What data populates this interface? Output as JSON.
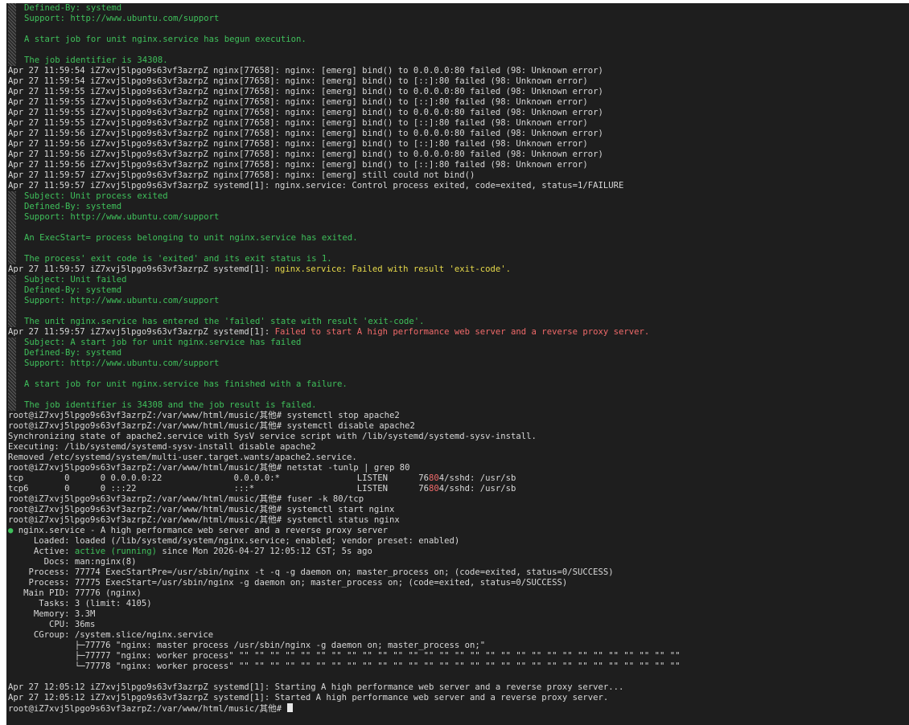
{
  "colors": {
    "background": "#1e1e1e",
    "text": "#d8d8d8",
    "journal": "#3fc05b",
    "warning": "#e6d94a",
    "error": "#f06a6a",
    "active": "#3fc05b"
  },
  "lines": [
    {
      "type": "journal",
      "text": "Defined-By: systemd"
    },
    {
      "type": "journal",
      "text": "Support: http://www.ubuntu.com/support"
    },
    {
      "type": "journal",
      "text": ""
    },
    {
      "type": "journal",
      "text": "A start job for unit nginx.service has begun execution."
    },
    {
      "type": "journal",
      "text": ""
    },
    {
      "type": "journal",
      "text": "The job identifier is 34308."
    },
    {
      "type": "text",
      "segments": [
        {
          "text": "Apr 27 11:59:54 iZ7xvj5lpgo9s63vf3azrpZ nginx[77658]: nginx: [emerg] bind() to 0.0.0.0:80 failed (98: Unknown error)",
          "color": "plain"
        }
      ]
    },
    {
      "type": "text",
      "segments": [
        {
          "text": "Apr 27 11:59:54 iZ7xvj5lpgo9s63vf3azrpZ nginx[77658]: nginx: [emerg] bind() to [::]:80 failed (98: Unknown error)",
          "color": "plain"
        }
      ]
    },
    {
      "type": "text",
      "segments": [
        {
          "text": "Apr 27 11:59:55 iZ7xvj5lpgo9s63vf3azrpZ nginx[77658]: nginx: [emerg] bind() to 0.0.0.0:80 failed (98: Unknown error)",
          "color": "plain"
        }
      ]
    },
    {
      "type": "text",
      "segments": [
        {
          "text": "Apr 27 11:59:55 iZ7xvj5lpgo9s63vf3azrpZ nginx[77658]: nginx: [emerg] bind() to [::]:80 failed (98: Unknown error)",
          "color": "plain"
        }
      ]
    },
    {
      "type": "text",
      "segments": [
        {
          "text": "Apr 27 11:59:55 iZ7xvj5lpgo9s63vf3azrpZ nginx[77658]: nginx: [emerg] bind() to 0.0.0.0:80 failed (98: Unknown error)",
          "color": "plain"
        }
      ]
    },
    {
      "type": "text",
      "segments": [
        {
          "text": "Apr 27 11:59:55 iZ7xvj5lpgo9s63vf3azrpZ nginx[77658]: nginx: [emerg] bind() to [::]:80 failed (98: Unknown error)",
          "color": "plain"
        }
      ]
    },
    {
      "type": "text",
      "segments": [
        {
          "text": "Apr 27 11:59:56 iZ7xvj5lpgo9s63vf3azrpZ nginx[77658]: nginx: [emerg] bind() to 0.0.0.0:80 failed (98: Unknown error)",
          "color": "plain"
        }
      ]
    },
    {
      "type": "text",
      "segments": [
        {
          "text": "Apr 27 11:59:56 iZ7xvj5lpgo9s63vf3azrpZ nginx[77658]: nginx: [emerg] bind() to [::]:80 failed (98: Unknown error)",
          "color": "plain"
        }
      ]
    },
    {
      "type": "text",
      "segments": [
        {
          "text": "Apr 27 11:59:56 iZ7xvj5lpgo9s63vf3azrpZ nginx[77658]: nginx: [emerg] bind() to 0.0.0.0:80 failed (98: Unknown error)",
          "color": "plain"
        }
      ]
    },
    {
      "type": "text",
      "segments": [
        {
          "text": "Apr 27 11:59:56 iZ7xvj5lpgo9s63vf3azrpZ nginx[77658]: nginx: [emerg] bind() to [::]:80 failed (98: Unknown error)",
          "color": "plain"
        }
      ]
    },
    {
      "type": "text",
      "segments": [
        {
          "text": "Apr 27 11:59:57 iZ7xvj5lpgo9s63vf3azrpZ nginx[77658]: nginx: [emerg] still could not bind()",
          "color": "plain"
        }
      ]
    },
    {
      "type": "text",
      "segments": [
        {
          "text": "Apr 27 11:59:57 iZ7xvj5lpgo9s63vf3azrpZ systemd[1]: nginx.service: Control process exited, code=exited, status=1/FAILURE",
          "color": "plain"
        }
      ]
    },
    {
      "type": "journal",
      "text": "Subject: Unit process exited"
    },
    {
      "type": "journal",
      "text": "Defined-By: systemd"
    },
    {
      "type": "journal",
      "text": "Support: http://www.ubuntu.com/support"
    },
    {
      "type": "journal",
      "text": ""
    },
    {
      "type": "journal",
      "text": "An ExecStart= process belonging to unit nginx.service has exited."
    },
    {
      "type": "journal",
      "text": ""
    },
    {
      "type": "journal",
      "text": "The process' exit code is 'exited' and its exit status is 1."
    },
    {
      "type": "text",
      "segments": [
        {
          "text": "Apr 27 11:59:57 iZ7xvj5lpgo9s63vf3azrpZ systemd[1]: ",
          "color": "plain"
        },
        {
          "text": "nginx.service: Failed with result 'exit-code'.",
          "color": "yellow"
        }
      ]
    },
    {
      "type": "journal",
      "text": "Subject: Unit failed"
    },
    {
      "type": "journal",
      "text": "Defined-By: systemd"
    },
    {
      "type": "journal",
      "text": "Support: http://www.ubuntu.com/support"
    },
    {
      "type": "journal",
      "text": ""
    },
    {
      "type": "journal",
      "text": "The unit nginx.service has entered the 'failed' state with result 'exit-code'."
    },
    {
      "type": "text",
      "segments": [
        {
          "text": "Apr 27 11:59:57 iZ7xvj5lpgo9s63vf3azrpZ systemd[1]: ",
          "color": "plain"
        },
        {
          "text": "Failed to start A high performance web server and a reverse proxy server.",
          "color": "red"
        }
      ]
    },
    {
      "type": "journal",
      "text": "Subject: A start job for unit nginx.service has failed"
    },
    {
      "type": "journal",
      "text": "Defined-By: systemd"
    },
    {
      "type": "journal",
      "text": "Support: http://www.ubuntu.com/support"
    },
    {
      "type": "journal",
      "text": ""
    },
    {
      "type": "journal",
      "text": "A start job for unit nginx.service has finished with a failure."
    },
    {
      "type": "journal",
      "text": ""
    },
    {
      "type": "journal",
      "text": "The job identifier is 34308 and the job result is failed."
    },
    {
      "type": "text",
      "segments": [
        {
          "text": "root@iZ7xvj5lpgo9s63vf3azrpZ:/var/www/html/music/其他# systemctl stop apache2",
          "color": "plain"
        }
      ]
    },
    {
      "type": "text",
      "segments": [
        {
          "text": "root@iZ7xvj5lpgo9s63vf3azrpZ:/var/www/html/music/其他# systemctl disable apache2",
          "color": "plain"
        }
      ]
    },
    {
      "type": "text",
      "segments": [
        {
          "text": "Synchronizing state of apache2.service with SysV service script with /lib/systemd/systemd-sysv-install.",
          "color": "plain"
        }
      ]
    },
    {
      "type": "text",
      "segments": [
        {
          "text": "Executing: /lib/systemd/systemd-sysv-install disable apache2",
          "color": "plain"
        }
      ]
    },
    {
      "type": "text",
      "segments": [
        {
          "text": "Removed /etc/systemd/system/multi-user.target.wants/apache2.service.",
          "color": "plain"
        }
      ]
    },
    {
      "type": "text",
      "segments": [
        {
          "text": "root@iZ7xvj5lpgo9s63vf3azrpZ:/var/www/html/music/其他# netstat -tunlp | grep 80",
          "color": "plain"
        }
      ]
    },
    {
      "type": "text",
      "segments": [
        {
          "text": "tcp        0      0 0.0.0.0:22              0.0.0.0:*               LISTEN      76",
          "color": "plain"
        },
        {
          "text": "80",
          "color": "red"
        },
        {
          "text": "4/sshd: /usr/sb",
          "color": "plain"
        }
      ]
    },
    {
      "type": "text",
      "segments": [
        {
          "text": "tcp6       0      0 :::22                   :::*                    LISTEN      76",
          "color": "plain"
        },
        {
          "text": "80",
          "color": "red"
        },
        {
          "text": "4/sshd: /usr/sb",
          "color": "plain"
        }
      ]
    },
    {
      "type": "text",
      "segments": [
        {
          "text": "root@iZ7xvj5lpgo9s63vf3azrpZ:/var/www/html/music/其他# fuser -k 80/tcp",
          "color": "plain"
        }
      ]
    },
    {
      "type": "text",
      "segments": [
        {
          "text": "root@iZ7xvj5lpgo9s63vf3azrpZ:/var/www/html/music/其他# systemctl start nginx",
          "color": "plain"
        }
      ]
    },
    {
      "type": "text",
      "segments": [
        {
          "text": "root@iZ7xvj5lpgo9s63vf3azrpZ:/var/www/html/music/其他# systemctl status nginx",
          "color": "plain"
        }
      ]
    },
    {
      "type": "text",
      "segments": [
        {
          "text": "● ",
          "color": "green"
        },
        {
          "text": "nginx.service - A high performance web server and a reverse proxy server",
          "color": "plain"
        }
      ]
    },
    {
      "type": "text",
      "segments": [
        {
          "text": "     Loaded: loaded (/lib/systemd/system/nginx.service; enabled; vendor preset: enabled)",
          "color": "plain"
        }
      ]
    },
    {
      "type": "text",
      "segments": [
        {
          "text": "     Active: ",
          "color": "plain"
        },
        {
          "text": "active (running)",
          "color": "green"
        },
        {
          "text": " since Mon 2026-04-27 12:05:12 CST; 5s ago",
          "color": "plain"
        }
      ]
    },
    {
      "type": "text",
      "segments": [
        {
          "text": "       Docs: man:nginx(8)",
          "color": "plain"
        }
      ]
    },
    {
      "type": "text",
      "segments": [
        {
          "text": "    Process: 77774 ExecStartPre=/usr/sbin/nginx -t -q -g daemon on; master_process on; (code=exited, status=0/SUCCESS)",
          "color": "plain"
        }
      ]
    },
    {
      "type": "text",
      "segments": [
        {
          "text": "    Process: 77775 ExecStart=/usr/sbin/nginx -g daemon on; master_process on; (code=exited, status=0/SUCCESS)",
          "color": "plain"
        }
      ]
    },
    {
      "type": "text",
      "segments": [
        {
          "text": "   Main PID: 77776 (nginx)",
          "color": "plain"
        }
      ]
    },
    {
      "type": "text",
      "segments": [
        {
          "text": "      Tasks: 3 (limit: 4105)",
          "color": "plain"
        }
      ]
    },
    {
      "type": "text",
      "segments": [
        {
          "text": "     Memory: 3.3M",
          "color": "plain"
        }
      ]
    },
    {
      "type": "text",
      "segments": [
        {
          "text": "        CPU: 36ms",
          "color": "plain"
        }
      ]
    },
    {
      "type": "text",
      "segments": [
        {
          "text": "     CGroup: /system.slice/nginx.service",
          "color": "plain"
        }
      ]
    },
    {
      "type": "text",
      "segments": [
        {
          "text": "             ├─77776 \"nginx: master process /usr/sbin/nginx -g daemon on; master_process on;\"",
          "color": "plain"
        }
      ]
    },
    {
      "type": "text",
      "segments": [
        {
          "text": "             ├─77777 \"nginx: worker process\" \"\" \"\" \"\" \"\" \"\" \"\" \"\" \"\" \"\" \"\" \"\" \"\" \"\" \"\" \"\" \"\" \"\" \"\" \"\" \"\" \"\" \"\" \"\" \"\" \"\" \"\" \"\" \"\" \"\"",
          "color": "plain"
        }
      ]
    },
    {
      "type": "text",
      "segments": [
        {
          "text": "             └─77778 \"nginx: worker process\" \"\" \"\" \"\" \"\" \"\" \"\" \"\" \"\" \"\" \"\" \"\" \"\" \"\" \"\" \"\" \"\" \"\" \"\" \"\" \"\" \"\" \"\" \"\" \"\" \"\" \"\" \"\" \"\" \"\"",
          "color": "plain"
        }
      ]
    },
    {
      "type": "text",
      "segments": [
        {
          "text": "",
          "color": "plain"
        }
      ]
    },
    {
      "type": "text",
      "segments": [
        {
          "text": "Apr 27 12:05:12 iZ7xvj5lpgo9s63vf3azrpZ systemd[1]: Starting A high performance web server and a reverse proxy server...",
          "color": "plain"
        }
      ]
    },
    {
      "type": "text",
      "segments": [
        {
          "text": "Apr 27 12:05:12 iZ7xvj5lpgo9s63vf3azrpZ systemd[1]: Started A high performance web server and a reverse proxy server.",
          "color": "plain"
        }
      ]
    },
    {
      "type": "prompt",
      "segments": [
        {
          "text": "root@iZ7xvj5lpgo9s63vf3azrpZ:/var/www/html/music/其他# ",
          "color": "plain"
        }
      ]
    }
  ]
}
